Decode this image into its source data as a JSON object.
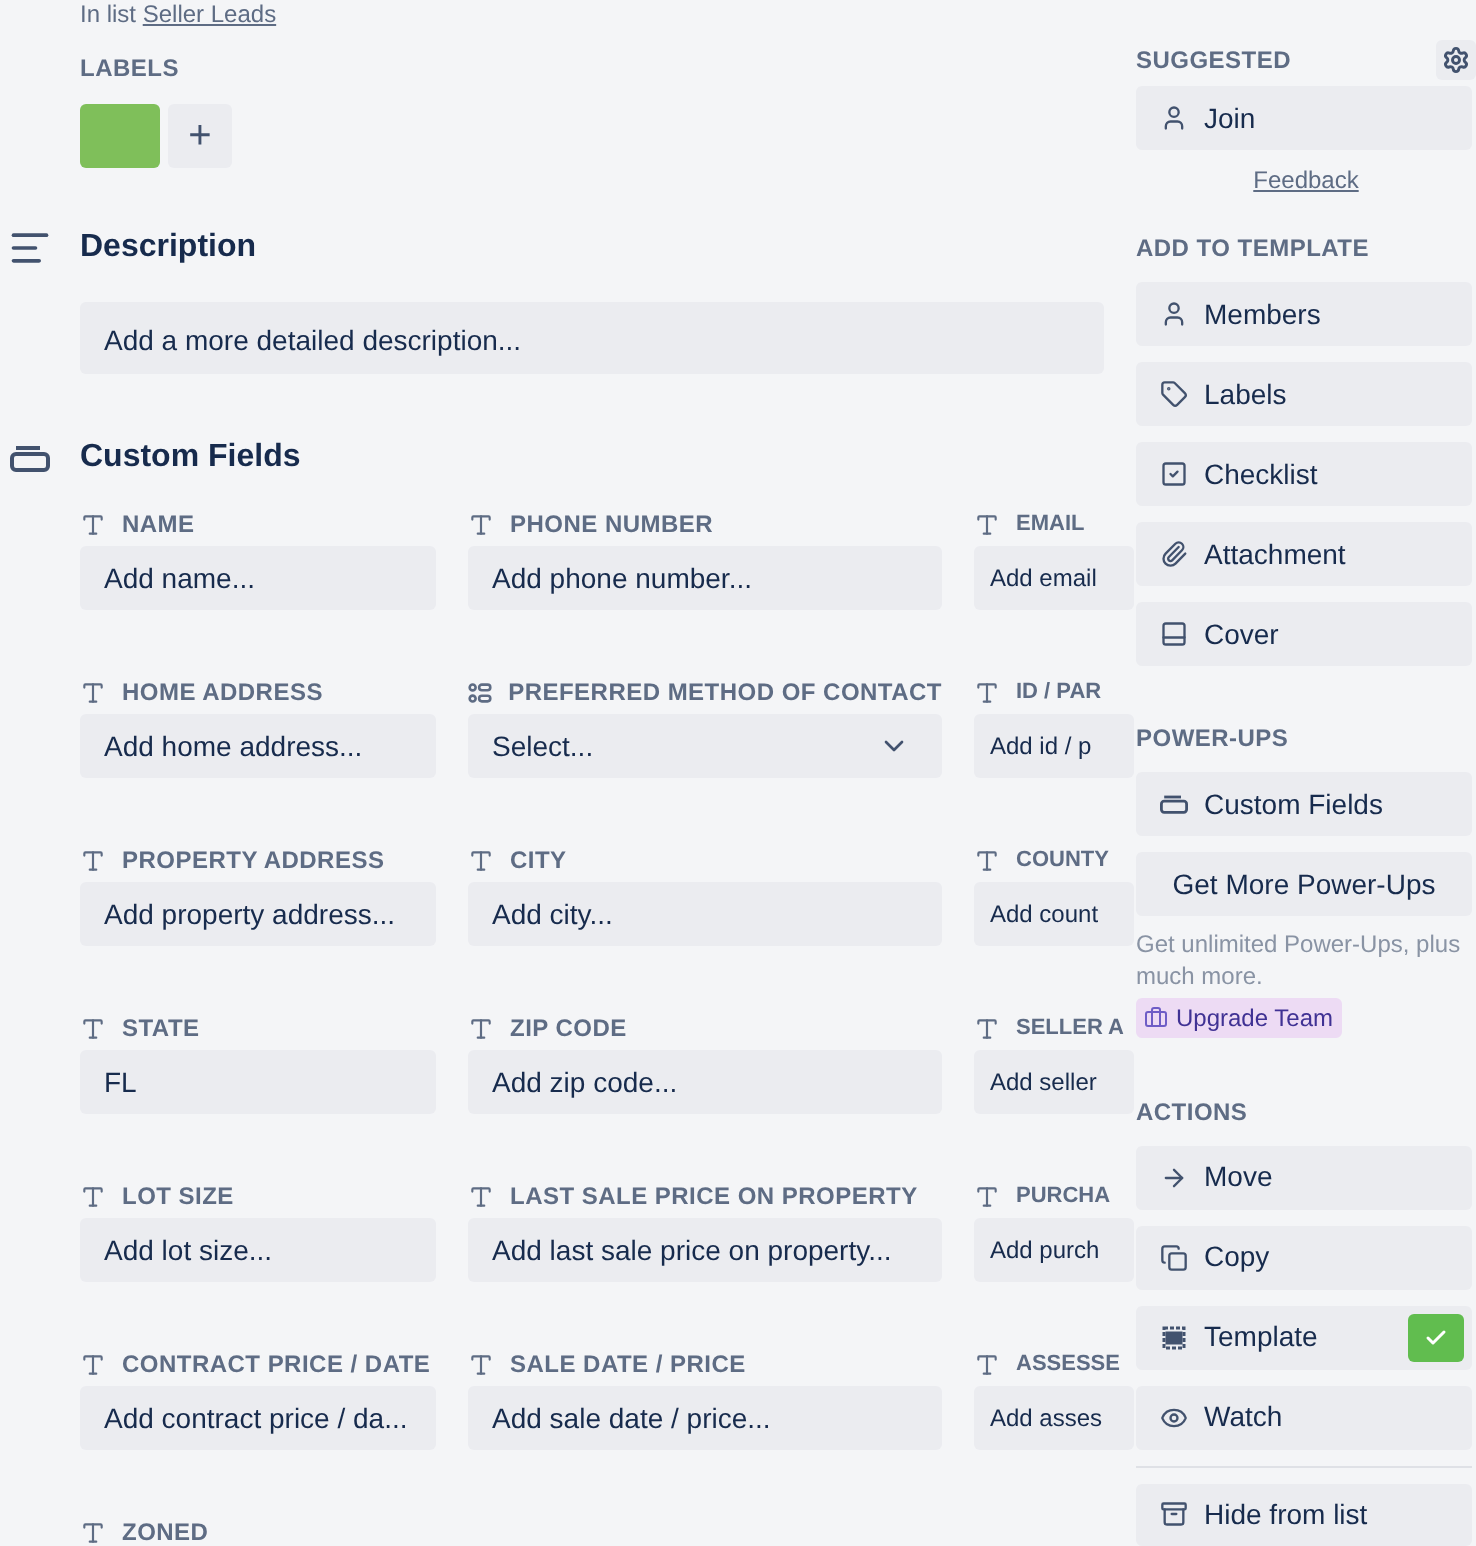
{
  "card": {
    "list_prefix": "In list",
    "list_link": "Seller Leads"
  },
  "labels": {
    "title": "LABELS",
    "items": [
      {
        "color": "#7fbf5a"
      }
    ],
    "add": "+"
  },
  "description": {
    "title": "Description",
    "placeholder": "Add a more detailed description..."
  },
  "custom_fields": {
    "title": "Custom Fields",
    "rows": [
      [
        {
          "kind": "text",
          "label": "NAME",
          "placeholder": "Add name..."
        },
        {
          "kind": "text",
          "label": "PHONE NUMBER",
          "placeholder": "Add phone number..."
        },
        {
          "kind": "text",
          "label": "EMAIL",
          "placeholder": "Add email"
        }
      ],
      [
        {
          "kind": "text",
          "label": "HOME ADDRESS",
          "placeholder": "Add home address..."
        },
        {
          "kind": "select",
          "label": "PREFERRED METHOD OF CONTACT",
          "placeholder": "Select..."
        },
        {
          "kind": "text",
          "label": "ID / PAR",
          "placeholder": "Add id / p"
        }
      ],
      [
        {
          "kind": "text",
          "label": "PROPERTY ADDRESS",
          "placeholder": "Add property address..."
        },
        {
          "kind": "text",
          "label": "CITY",
          "placeholder": "Add city..."
        },
        {
          "kind": "text",
          "label": "COUNTY",
          "placeholder": "Add count"
        }
      ],
      [
        {
          "kind": "text",
          "label": "STATE",
          "value": "FL"
        },
        {
          "kind": "text",
          "label": "ZIP CODE",
          "placeholder": "Add zip code..."
        },
        {
          "kind": "text",
          "label": "SELLER A",
          "placeholder": "Add seller"
        }
      ],
      [
        {
          "kind": "text",
          "label": "LOT SIZE",
          "placeholder": "Add lot size..."
        },
        {
          "kind": "text",
          "label": "LAST SALE PRICE ON PROPERTY",
          "placeholder": "Add last sale price on property..."
        },
        {
          "kind": "text",
          "label": "PURCHA",
          "placeholder": "Add purch"
        }
      ],
      [
        {
          "kind": "text",
          "label": "CONTRACT PRICE / DATE",
          "placeholder": "Add contract price / da..."
        },
        {
          "kind": "text",
          "label": "SALE DATE / PRICE",
          "placeholder": "Add sale date / price..."
        },
        {
          "kind": "text",
          "label": "ASSESSE",
          "placeholder": "Add asses"
        }
      ],
      [
        {
          "kind": "text",
          "label": "ZONED"
        }
      ]
    ]
  },
  "sidebar": {
    "suggested": {
      "title": "SUGGESTED",
      "buttons": [
        "Join"
      ],
      "feedback": "Feedback"
    },
    "add_to_template": {
      "title": "ADD TO TEMPLATE",
      "buttons": [
        "Members",
        "Labels",
        "Checklist",
        "Attachment",
        "Cover"
      ]
    },
    "power_ups": {
      "title": "POWER-UPS",
      "buttons": [
        "Custom Fields"
      ],
      "more": "Get More Power-Ups",
      "note": "Get unlimited Power-Ups, plus much more.",
      "upgrade": "Upgrade Team"
    },
    "actions": {
      "title": "ACTIONS",
      "buttons": [
        {
          "label": "Move"
        },
        {
          "label": "Copy"
        },
        {
          "label": "Template",
          "checked": true
        },
        {
          "label": "Watch"
        }
      ],
      "hide": "Hide from list"
    }
  }
}
